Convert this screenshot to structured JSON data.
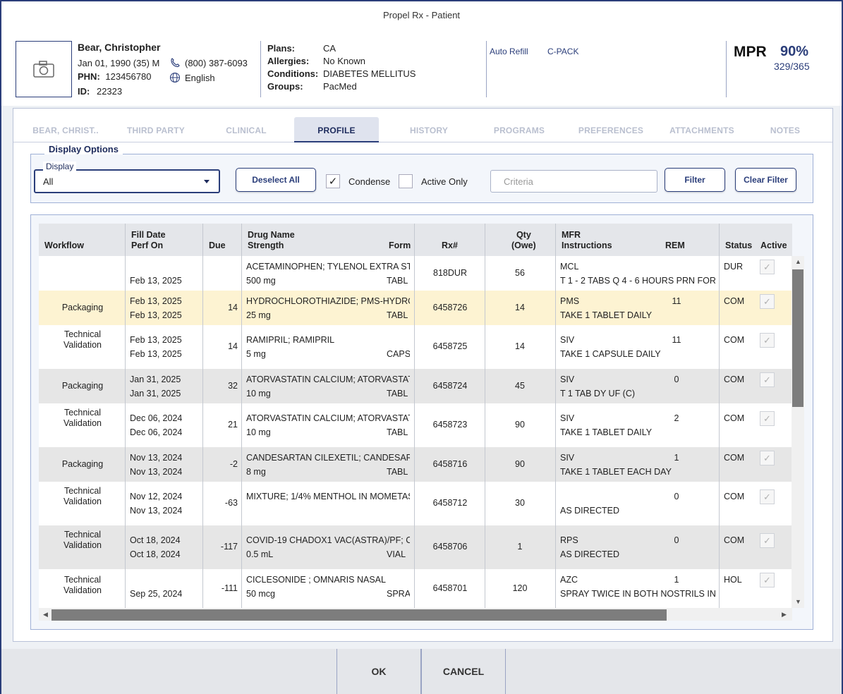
{
  "window": {
    "title": "Propel Rx - Patient"
  },
  "patient": {
    "name": "Bear, Christopher",
    "dob": "Jan 01, 1990 (35) M",
    "phone": "(800) 387-6093",
    "phn_label": "PHN:",
    "phn": "123456780",
    "language": "English",
    "id_label": "ID:",
    "id": "22323"
  },
  "info": {
    "plans_label": "Plans:",
    "plans": "CA",
    "allergies_label": "Allergies:",
    "allergies": "No Known",
    "conditions_label": "Conditions:",
    "conditions": "DIABETES MELLITUS",
    "groups_label": "Groups:",
    "groups": "PacMed"
  },
  "links": {
    "auto_refill": "Auto Refill",
    "cpack": "C-PACK"
  },
  "mpr": {
    "label": "MPR",
    "percent": "90%",
    "fraction": "329/365"
  },
  "tabs": [
    {
      "label": "BEAR, CHRIST.."
    },
    {
      "label": "THIRD PARTY"
    },
    {
      "label": "CLINICAL"
    },
    {
      "label": "PROFILE"
    },
    {
      "label": "HISTORY"
    },
    {
      "label": "PROGRAMS"
    },
    {
      "label": "PREFERENCES"
    },
    {
      "label": "ATTACHMENTS"
    },
    {
      "label": "NOTES"
    }
  ],
  "options": {
    "legend": "Display Options",
    "display_label": "Display",
    "display_value": "All",
    "deselect_all": "Deselect All",
    "condense_label": "Condense",
    "active_only_label": "Active Only",
    "criteria_placeholder": "Criteria",
    "filter": "Filter",
    "clear_filter": "Clear Filter"
  },
  "table": {
    "headers": {
      "workflow": "Workflow",
      "fill_date": "Fill Date",
      "perf_on": "Perf On",
      "due": "Due",
      "drug_name": "Drug Name",
      "strength": "Strength",
      "form": "Form",
      "rx": "Rx#",
      "qty": "Qty",
      "owe": "(Owe)",
      "mfr": "MFR",
      "instructions": "Instructions",
      "rem": "REM",
      "status": "Status",
      "active": "Active"
    },
    "rows": [
      {
        "workflow": "",
        "fill": "",
        "perf": "Feb 13, 2025",
        "due": "",
        "drug": "ACETAMINOPHEN; TYLENOL EXTRA ST",
        "strength": "500 mg",
        "form": "TABL",
        "rx": "818DUR",
        "qty": "56",
        "mfr": "MCL",
        "instr": "T 1 - 2 TABS Q 4 - 6 HOURS PRN FOR",
        "rem": "",
        "status": "DUR"
      },
      {
        "workflow": "Packaging",
        "fill": "Feb 13, 2025",
        "perf": "Feb 13, 2025",
        "due": "14",
        "drug": "HYDROCHLOROTHIAZIDE; PMS-HYDRO",
        "strength": "25 mg",
        "form": "TABL",
        "rx": "6458726",
        "qty": "14",
        "mfr": "PMS",
        "instr": "TAKE 1 TABLET DAILY",
        "rem": "11",
        "status": "COM"
      },
      {
        "workflow": "Technical Validation",
        "fill": "Feb 13, 2025",
        "perf": "Feb 13, 2025",
        "due": "14",
        "drug": "RAMIPRIL; RAMIPRIL",
        "strength": "5 mg",
        "form": "CAPS",
        "rx": "6458725",
        "qty": "14",
        "mfr": "SIV",
        "instr": "TAKE 1 CAPSULE DAILY",
        "rem": "11",
        "status": "COM"
      },
      {
        "workflow": "Packaging",
        "fill": "Jan 31, 2025",
        "perf": "Jan 31, 2025",
        "due": "32",
        "drug": "ATORVASTATIN CALCIUM; ATORVASTAT",
        "strength": "10 mg",
        "form": "TABL",
        "rx": "6458724",
        "qty": "45",
        "mfr": "SIV",
        "instr": "T 1 TAB DY UF (C)",
        "rem": "0",
        "status": "COM"
      },
      {
        "workflow": "Technical Validation",
        "fill": "Dec 06, 2024",
        "perf": "Dec 06, 2024",
        "due": "21",
        "drug": "ATORVASTATIN CALCIUM; ATORVASTAT",
        "strength": "10 mg",
        "form": "TABL",
        "rx": "6458723",
        "qty": "90",
        "mfr": "SIV",
        "instr": "TAKE 1 TABLET DAILY",
        "rem": "2",
        "status": "COM"
      },
      {
        "workflow": "Packaging",
        "fill": "Nov 13, 2024",
        "perf": "Nov 13, 2024",
        "due": "-2",
        "drug": "CANDESARTAN CILEXETIL; CANDESAR",
        "strength": "8 mg",
        "form": "TABL",
        "rx": "6458716",
        "qty": "90",
        "mfr": "SIV",
        "instr": "TAKE 1 TABLET EACH DAY",
        "rem": "1",
        "status": "COM"
      },
      {
        "workflow": "Technical Validation",
        "fill": "Nov 12, 2024",
        "perf": "Nov 13, 2024",
        "due": "-63",
        "drug": "MIXTURE; 1/4% MENTHOL IN MOMETAS",
        "strength": "",
        "form": "",
        "rx": "6458712",
        "qty": "30",
        "mfr": "",
        "instr": "AS DIRECTED",
        "rem": "0",
        "status": "COM"
      },
      {
        "workflow": "Technical Validation",
        "fill": "Oct 18, 2024",
        "perf": "Oct 18, 2024",
        "due": "-117",
        "drug": "COVID-19 CHADOX1 VAC(ASTRA)/PF; C",
        "strength": "0.5 mL",
        "form": "VIAL",
        "rx": "6458706",
        "qty": "1",
        "mfr": "RPS",
        "instr": "AS DIRECTED",
        "rem": "0",
        "status": "COM"
      },
      {
        "workflow": "Technical Validation",
        "fill": "",
        "perf": "Sep 25, 2024",
        "due": "-111",
        "drug": "CICLESONIDE ; OMNARIS NASAL",
        "strength": "50 mcg",
        "form": "SPRA",
        "rx": "6458701",
        "qty": "120",
        "mfr": "AZC",
        "instr": "SPRAY TWICE IN BOTH NOSTRILS IN",
        "rem": "1",
        "status": "HOL"
      }
    ]
  },
  "footer": {
    "ok": "OK",
    "cancel": "CANCEL"
  },
  "colors": {
    "accent": "#2b3e7a",
    "selected_row": "#fdf3d2",
    "alt_row": "#e6e6e6"
  }
}
